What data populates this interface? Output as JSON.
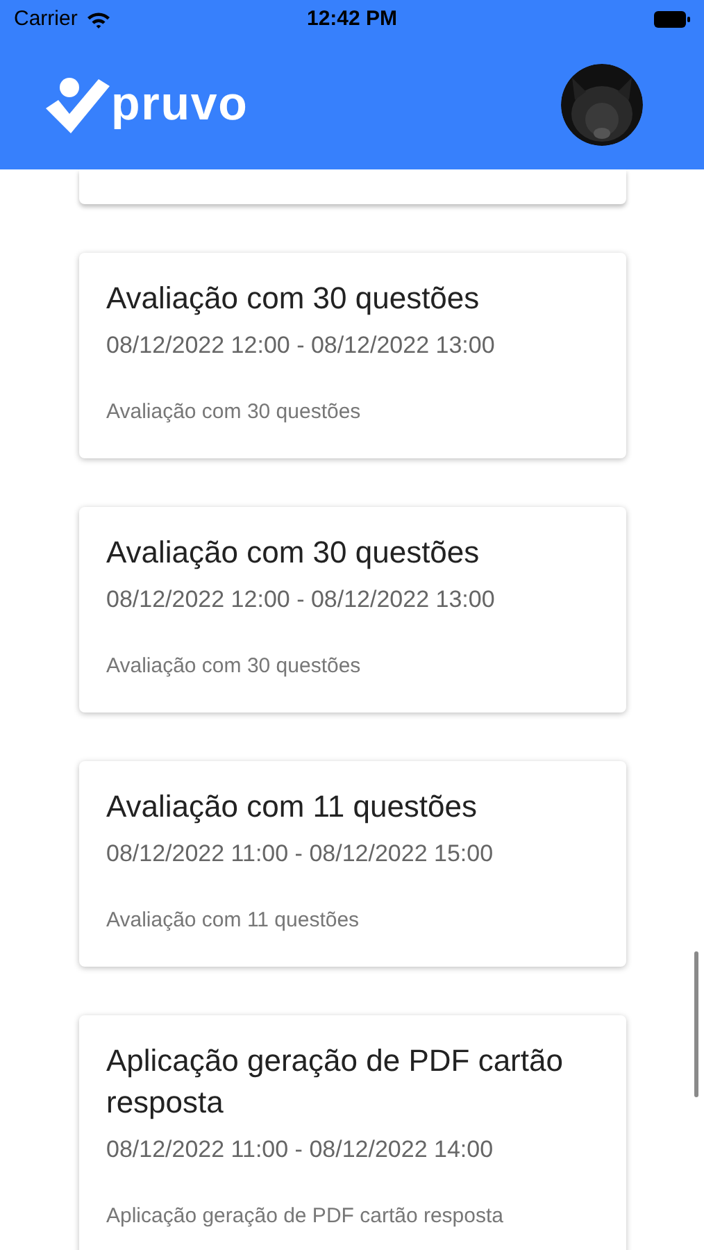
{
  "status_bar": {
    "carrier": "Carrier",
    "time": "12:42 PM"
  },
  "header": {
    "logo_text": "pruvo"
  },
  "cards": [
    {
      "title": "Avaliação com 30 questões",
      "dates": "08/12/2022 12:00 - 08/12/2022 13:00",
      "description": "Avaliação com 30 questões"
    },
    {
      "title": "Avaliação com 30 questões",
      "dates": "08/12/2022 12:00 - 08/12/2022 13:00",
      "description": "Avaliação com 30 questões"
    },
    {
      "title": "Avaliação com 11 questões",
      "dates": "08/12/2022 11:00 - 08/12/2022 15:00",
      "description": "Avaliação com 11 questões"
    },
    {
      "title": "Aplicação geração de PDF cartão resposta",
      "dates": "08/12/2022 11:00 - 08/12/2022 14:00",
      "description": "Aplicação geração de PDF cartão resposta"
    }
  ]
}
